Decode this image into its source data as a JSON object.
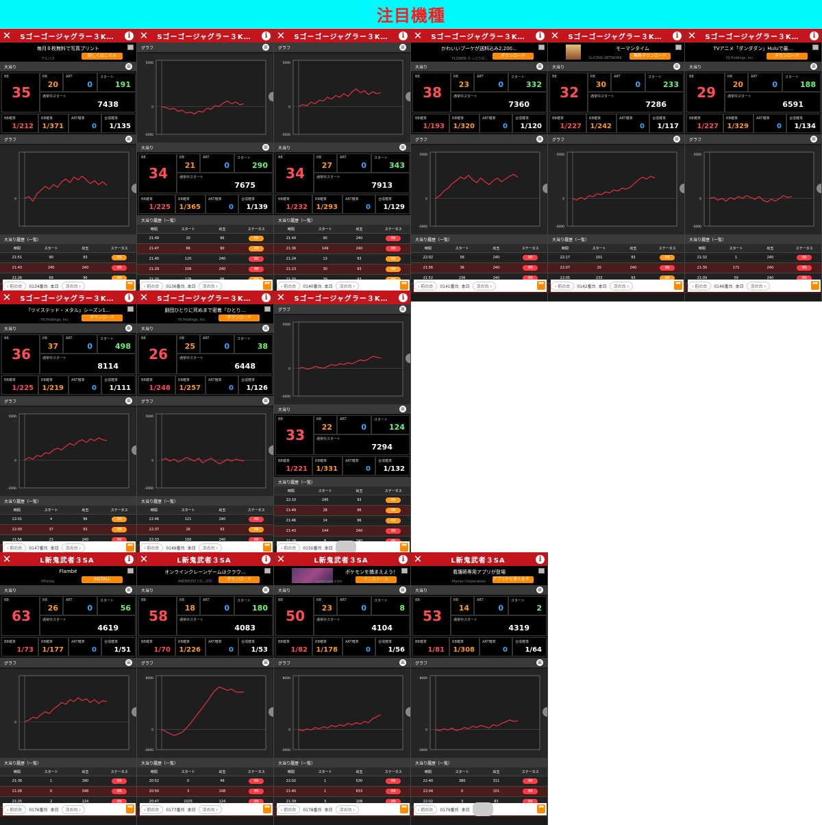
{
  "header": {
    "title": "注目機種"
  },
  "labels": {
    "ootari": "大当り",
    "graph": "グラフ",
    "history": "大当り履歴（一覧）",
    "bb": "BB",
    "rb": "RB",
    "art": "ART",
    "start": "スタート",
    "normal_start": "通常中スタート",
    "bb_prob": "BB確率",
    "rb_prob": "RB確率",
    "art_prob": "ART確率",
    "total_prob": "合成確率",
    "col_time": "時間",
    "col_start": "スタート",
    "col_out": "出玉",
    "col_status": "ステータス",
    "prev": "前の台",
    "next": "次の台",
    "today": "本日",
    "close": "✕",
    "info": "i"
  },
  "panels": [
    {
      "machine": "Sゴーゴージャグラー３K…",
      "ad": {
        "text": "毎月８枚無料で写真プリント",
        "adv": "アルバス",
        "btn": "詳しくはこちら",
        "img": "none"
      },
      "bb": "35",
      "rb": "20",
      "art": "0",
      "start": "191",
      "normal": "7438",
      "bbp": "1/212",
      "rbp": "1/371",
      "artp": "0",
      "total": "1/135",
      "ymax": "",
      "ymin": "",
      "graph": [
        0,
        0.2,
        -0.3,
        0.5,
        0.9,
        1.3,
        1.0,
        1.5,
        1.2,
        1.8,
        2.1,
        1.7,
        2.3,
        2.0,
        2.4,
        2.0,
        1.6,
        1.9,
        1.5,
        1.8,
        1.4
      ],
      "unit": "0134番台",
      "history": [
        [
          "21:51",
          "90",
          "93",
          "RB"
        ],
        [
          "21:43",
          "240",
          "240",
          "BB"
        ],
        [
          "21:26",
          "69",
          "96",
          "RB"
        ],
        [
          "21:20",
          "427",
          "240",
          "BB"
        ]
      ],
      "order": "ad-first"
    },
    {
      "machine": "Sゴーゴージャグラー３K…",
      "ad": null,
      "bb": "34",
      "rb": "21",
      "art": "0",
      "start": "290",
      "normal": "7675",
      "bbp": "1/225",
      "rbp": "1/365",
      "artp": "0",
      "total": "1/139",
      "ymax": "5000",
      "ymin": "-3000",
      "graph": [
        0,
        -0.1,
        -0.3,
        -0.2,
        -0.5,
        -0.4,
        -0.7,
        -0.6,
        -0.8,
        -0.5,
        -0.6,
        -0.2,
        -0.3,
        0.1,
        0.0,
        0.4,
        0.6,
        0.3,
        0.5,
        0.2,
        0.3
      ],
      "unit": "0136番台",
      "history": [
        [
          "21:49",
          "10",
          "96",
          "RB"
        ],
        [
          "21:47",
          "66",
          "90",
          "RB"
        ],
        [
          "21:40",
          "120",
          "240",
          "BB"
        ],
        [
          "21:29",
          "106",
          "240",
          "BB"
        ],
        [
          "21:20",
          "176",
          "96",
          "RB"
        ]
      ],
      "order": "graph-first"
    },
    {
      "machine": "Sゴーゴージャグラー３K…",
      "ad": null,
      "bb": "34",
      "rb": "27",
      "art": "0",
      "start": "343",
      "normal": "7913",
      "bbp": "1/232",
      "rbp": "1/293",
      "artp": "0",
      "total": "1/129",
      "ymax": "5000",
      "ymin": "-3000",
      "graph": [
        0,
        0.2,
        0.1,
        0.5,
        0.3,
        0.7,
        0.6,
        1.0,
        0.8,
        1.2,
        1.0,
        1.4,
        1.1,
        1.6,
        1.9,
        1.5,
        1.7,
        1.3,
        1.6,
        1.4,
        1.5
      ],
      "unit": "0140番台",
      "history": [
        [
          "21:44",
          "90",
          "240",
          "BB"
        ],
        [
          "21:36",
          "149",
          "240",
          "BB"
        ],
        [
          "21:24",
          "13",
          "93",
          "RB"
        ],
        [
          "21:23",
          "30",
          "93",
          "RB"
        ],
        [
          "21:20",
          "39",
          "93",
          "RB"
        ]
      ],
      "order": "graph-first"
    },
    {
      "machine": "Sゴーゴージャグラー３K…",
      "ad": {
        "text": "かわいいブーケが送料込み2,200…",
        "adv": "FLOWER たっぷりの…",
        "btn": "ダウンロード",
        "img": "none"
      },
      "bb": "38",
      "rb": "23",
      "art": "0",
      "start": "332",
      "normal": "7360",
      "bbp": "1/193",
      "rbp": "1/320",
      "artp": "0",
      "total": "1/120",
      "ymax": "5000",
      "ymin": "-3000",
      "graph": [
        0,
        0.3,
        0.8,
        1.1,
        1.6,
        1.9,
        2.3,
        2.1,
        2.5,
        2.0,
        1.7,
        2.2,
        1.8,
        1.5,
        1.9,
        2.2,
        1.8,
        2.1,
        2.4,
        2.6,
        2.3
      ],
      "unit": "0141番台",
      "history": [
        [
          "22:02",
          "56",
          "240",
          "BB"
        ],
        [
          "21:56",
          "36",
          "240",
          "BB"
        ],
        [
          "21:52",
          "236",
          "240",
          "BB"
        ],
        [
          "21:33",
          "83",
          "242",
          "BB"
        ]
      ],
      "order": "ad-first"
    },
    {
      "machine": "Sゴーゴージャグラー３K…",
      "ad": {
        "text": "モーマンタイム",
        "adv": "G-CONG NETWORK",
        "btn": "無料ダウンロード",
        "img": "food"
      },
      "bb": "32",
      "rb": "30",
      "art": "0",
      "start": "233",
      "normal": "7286",
      "bbp": "1/227",
      "rbp": "1/242",
      "artp": "0",
      "total": "1/117",
      "ymax": "5000",
      "ymin": "-3000",
      "graph": [
        0,
        -0.2,
        0.1,
        -0.1,
        0.3,
        0.2,
        0.5,
        0.4,
        0.7,
        0.6,
        0.9,
        0.8,
        1.1,
        1.0,
        1.2,
        1.6,
        2.0,
        2.3,
        2.1,
        2.4,
        2.2
      ],
      "unit": "0142番台",
      "history": [
        [
          "22:17",
          "101",
          "93",
          "RB"
        ],
        [
          "22:07",
          "20",
          "240",
          "BB"
        ],
        [
          "22:05",
          "233",
          "93",
          "RB"
        ],
        [
          "21:41",
          "95",
          "240",
          "BB"
        ]
      ],
      "order": "ad-first"
    },
    {
      "machine": "Sゴーゴージャグラー３K…",
      "ad": {
        "text": "TVアニメ「ダンダダン」Huluで最…",
        "adv": "HJ Holdings, Inc.",
        "btn": "ダウンロード",
        "img": "none"
      },
      "bb": "29",
      "rb": "20",
      "art": "0",
      "start": "188",
      "normal": "6591",
      "bbp": "1/227",
      "rbp": "1/329",
      "artp": "0",
      "total": "1/134",
      "ymax": "5000",
      "ymin": "-3000",
      "graph": [
        0,
        0.1,
        -0.2,
        0.0,
        -0.3,
        0.1,
        -0.1,
        0.2,
        0.0,
        0.3,
        0.1,
        -0.1,
        0.2,
        -0.2,
        -0.4,
        -0.1,
        -0.3,
        0.0,
        0.3,
        0.1,
        0.2
      ],
      "unit": "0146番台",
      "history": [
        [
          "21:32",
          "1",
          "240",
          "BB"
        ],
        [
          "21:30",
          "171",
          "240",
          "BB"
        ],
        [
          "21:09",
          "59",
          "240",
          "BB"
        ],
        [
          "21:00",
          "0",
          "240",
          "BB"
        ]
      ],
      "order": "ad-first"
    },
    {
      "machine": "Sゴーゴージャグラー３K…",
      "ad": {
        "text": "『ツイステッド・メタル』シーズン1…",
        "adv": "HJ Holdings, Inc.",
        "btn": "ダウンロード",
        "img": "none"
      },
      "bb": "36",
      "rb": "37",
      "art": "0",
      "start": "498",
      "normal": "8114",
      "bbp": "1/225",
      "rbp": "1/219",
      "artp": "0",
      "total": "1/111",
      "ymax": "5000",
      "ymin": "-3000",
      "graph": [
        0,
        0.3,
        0.1,
        0.5,
        0.4,
        0.8,
        0.7,
        1.1,
        1.3,
        1.1,
        1.5,
        1.8,
        1.6,
        2.0,
        2.2,
        1.9,
        2.3,
        2.1,
        2.4,
        2.2,
        2.1
      ],
      "unit": "0147番台",
      "history": [
        [
          "22:01",
          "4",
          "96",
          "RB"
        ],
        [
          "22:00",
          "37",
          "93",
          "RB"
        ],
        [
          "21:56",
          "23",
          "240",
          "BB"
        ],
        [
          "21:53",
          "25",
          "240",
          "BB"
        ]
      ],
      "order": "ad-first"
    },
    {
      "machine": "Sゴーゴージャグラー３K…",
      "ad": {
        "text": "劇団ひとりに死ぬまで密着「ひとり…",
        "adv": "HJ Holdings, Inc.",
        "btn": "ダウンロード",
        "img": "none"
      },
      "bb": "26",
      "rb": "25",
      "art": "0",
      "start": "38",
      "normal": "6448",
      "bbp": "1/248",
      "rbp": "1/257",
      "artp": "0",
      "total": "1/126",
      "ymax": "5000",
      "ymin": "-3000",
      "graph": [
        0,
        0.2,
        -0.1,
        0.1,
        -0.2,
        0.0,
        0.3,
        0.1,
        -0.1,
        0.2,
        -0.3,
        0.0,
        0.2,
        -0.1,
        -0.4,
        -0.2,
        0.1,
        -0.1,
        0.1,
        0.0,
        -0.1
      ],
      "unit": "0149番台",
      "history": [
        [
          "22:46",
          "121",
          "240",
          "BB"
        ],
        [
          "22:37",
          "26",
          "93",
          "RB"
        ],
        [
          "22:33",
          "100",
          "240",
          "BB"
        ],
        [
          "22:25",
          "7",
          "239",
          "BB"
        ]
      ],
      "order": "ad-first"
    },
    {
      "machine": "Sゴーゴージャグラー３K…",
      "ad": null,
      "bb": "33",
      "rb": "22",
      "art": "0",
      "start": "124",
      "normal": "7294",
      "bbp": "1/221",
      "rbp": "1/331",
      "artp": "0",
      "total": "1/132",
      "ymax": "5000",
      "ymin": "-3000",
      "graph": [
        0,
        0.1,
        -0.1,
        0.0,
        0.2,
        0.1,
        0.0,
        0.2,
        0.4,
        0.3,
        0.5,
        0.4,
        0.6,
        0.5,
        0.7,
        0.9,
        0.8,
        1.0,
        1.3,
        1.2,
        1.1
      ],
      "unit": "0150番台",
      "history": [
        [
          "22:10",
          "245",
          "93",
          "RB"
        ],
        [
          "21:49",
          "28",
          "96",
          "RB"
        ],
        [
          "21:46",
          "14",
          "96",
          "RB"
        ],
        [
          "21:43",
          "144",
          "240",
          "BB"
        ],
        [
          "21:28",
          "8",
          "240",
          "BB"
        ]
      ],
      "order": "graph-first"
    },
    {
      "machine": "L新鬼武者３SA",
      "ad": {
        "text": "Flambé",
        "adv": "HP.Icola",
        "btn": "INSTALL",
        "img": "none"
      },
      "bb": "63",
      "rb": "26",
      "art": "0",
      "start": "56",
      "normal": "4619",
      "bbp": "1/73",
      "rbp": "1/177",
      "artp": "0",
      "total": "1/51",
      "ymax": "",
      "ymin": "",
      "graph": [
        0,
        0.2,
        0.5,
        0.4,
        0.8,
        1.1,
        0.9,
        1.4,
        1.7,
        2.1,
        1.9,
        2.4,
        2.2,
        2.6,
        2.3,
        2.5,
        2.1,
        2.4,
        2.0,
        2.3,
        2.2
      ],
      "unit": "0176番台",
      "history": [
        [
          "21:36",
          "1",
          "180",
          "BB"
        ],
        [
          "21:26",
          "0",
          "348",
          "BB"
        ],
        [
          "21:25",
          "2",
          "124",
          "BB"
        ],
        [
          "21:03",
          "928",
          "567",
          "BB"
        ]
      ],
      "order": "ad-first"
    },
    {
      "machine": "L新鬼武者３SA",
      "ad": {
        "text": "オンラインクレーンゲームはクラウ…",
        "adv": "ANTEPOST CO., LTD.",
        "btn": "ダウンロード",
        "img": "none"
      },
      "bb": "58",
      "rb": "18",
      "art": "0",
      "start": "180",
      "normal": "4083",
      "bbp": "1/70",
      "rbp": "1/226",
      "artp": "0",
      "total": "1/53",
      "ymax": "8000",
      "ymin": "-3000",
      "graph": [
        0,
        -0.3,
        -0.6,
        -0.9,
        -0.7,
        -0.4,
        0.2,
        0.9,
        1.7,
        2.5,
        3.3,
        4.1,
        5.0,
        5.8,
        6.3,
        6.1,
        5.8,
        6.0,
        5.6,
        5.5,
        5.6
      ],
      "unit": "0177番台",
      "history": [
        [
          "20:52",
          "0",
          "49",
          "BB"
        ],
        [
          "20:50",
          "3",
          "108",
          "BB"
        ],
        [
          "20:47",
          "1025",
          "124",
          "BB"
        ],
        [
          "19:32",
          "1",
          "91",
          "BB"
        ]
      ],
      "order": "ad-first"
    },
    {
      "machine": "L新鬼武者３SA",
      "ad": {
        "text": "ポケモンを捕まえよう！",
        "adv": "nianticlabs.com",
        "btn": "インストール",
        "img": "game"
      },
      "bb": "50",
      "rb": "23",
      "art": "0",
      "start": "8",
      "normal": "4104",
      "bbp": "1/82",
      "rbp": "1/178",
      "artp": "0",
      "total": "1/56",
      "ymax": "8000",
      "ymin": "-3000",
      "graph": [
        0,
        -0.2,
        0.1,
        -0.1,
        0.3,
        0.1,
        0.4,
        0.2,
        0.6,
        0.4,
        0.7,
        0.5,
        0.9,
        0.7,
        1.0,
        0.8,
        1.2,
        1.0,
        1.6,
        1.9,
        2.2
      ],
      "unit": "0178番台",
      "history": [
        [
          "22:02",
          "1",
          "530",
          "BB"
        ],
        [
          "21:40",
          "1",
          "633",
          "BB"
        ],
        [
          "21:39",
          "3",
          "108",
          "BB"
        ],
        [
          "21:37",
          "1",
          "41",
          "BB"
        ]
      ],
      "order": "ad-first"
    },
    {
      "machine": "L新鬼武者３SA",
      "ad": {
        "text": "看護師専用アプリが登場",
        "adv": "Mynavi Corporation",
        "btn": "アプリから求人をチ…",
        "img": "none"
      },
      "bb": "53",
      "rb": "14",
      "art": "0",
      "start": "2",
      "normal": "4319",
      "bbp": "1/81",
      "rbp": "1/308",
      "artp": "0",
      "total": "1/64",
      "ymax": "8000",
      "ymin": "-3000",
      "graph": [
        0,
        -0.2,
        0.1,
        -0.1,
        0.2,
        -0.2,
        0.0,
        0.3,
        0.1,
        0.5,
        0.3,
        0.6,
        0.4,
        0.2,
        0.7,
        0.5,
        0.9,
        1.1,
        1.4,
        1.2,
        1.3
      ],
      "unit": "0179番台",
      "history": [
        [
          "22:40",
          "380",
          "311",
          "BB"
        ],
        [
          "22:04",
          "0",
          "101",
          "BB"
        ],
        [
          "22:02",
          "3",
          "83",
          "BB"
        ],
        [
          "22:00",
          "1",
          "108",
          "BB"
        ]
      ],
      "order": "ad-first"
    }
  ]
}
